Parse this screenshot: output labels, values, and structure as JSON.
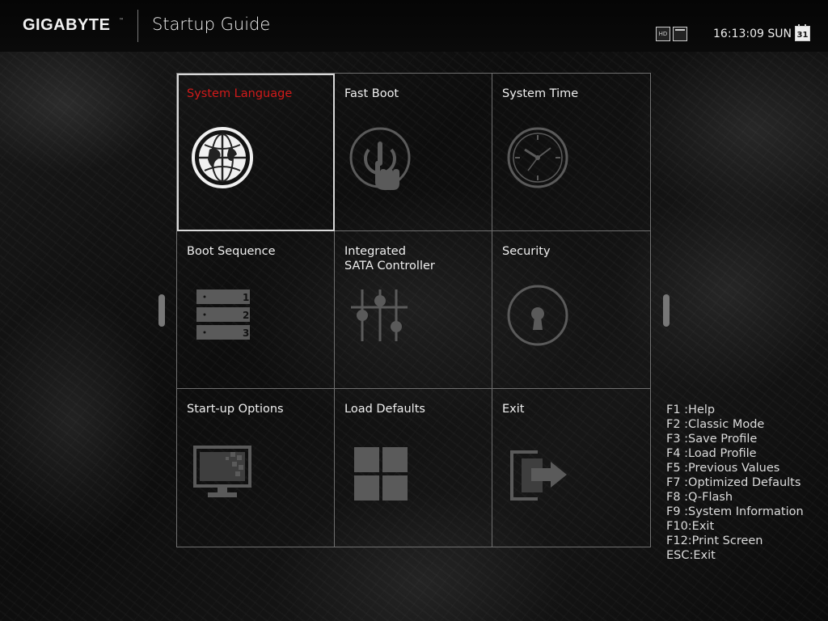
{
  "header": {
    "brand": "GIGABYTE",
    "brand_tm": "TM",
    "title": "Startup Guide",
    "status_icons": [
      "hd-icon",
      "grid-view-icon",
      "window-icon"
    ],
    "time": "16:13:09 SUN",
    "calendar_day": "31"
  },
  "tiles": [
    {
      "label": "System Language",
      "icon": "globe-icon",
      "selected": true
    },
    {
      "label": "Fast Boot",
      "icon": "power-touch-icon",
      "selected": false
    },
    {
      "label": "System Time",
      "icon": "clock-icon",
      "selected": false
    },
    {
      "label": "Boot Sequence",
      "icon": "boot-order-icon",
      "selected": false,
      "boot_numbers": [
        "1",
        "2",
        "3"
      ]
    },
    {
      "label": "Integrated\nSATA Controller",
      "label_lines": [
        "Integrated",
        "SATA Controller"
      ],
      "icon": "sliders-icon",
      "selected": false
    },
    {
      "label": "Security",
      "icon": "lock-icon",
      "selected": false
    },
    {
      "label": "Start-up Options",
      "icon": "monitor-icon",
      "selected": false
    },
    {
      "label": "Load Defaults",
      "icon": "four-squares-icon",
      "selected": false
    },
    {
      "label": "Exit",
      "icon": "exit-icon",
      "selected": false
    }
  ],
  "hotkeys": [
    "F1 :Help",
    "F2 :Classic Mode",
    "F3 :Save Profile",
    "F4 :Load Profile",
    "F5 :Previous Values",
    "F7 :Optimized Defaults",
    "F8 :Q-Flash",
    "F9 :System Information",
    "F10:Exit",
    "F12:Print Screen",
    "ESC:Exit"
  ],
  "colors": {
    "selected_label": "#d11a1a",
    "grid_line": "#6f6f6f",
    "icon_dim": "#5a5a5a",
    "icon_active": "#f0f0f0"
  }
}
